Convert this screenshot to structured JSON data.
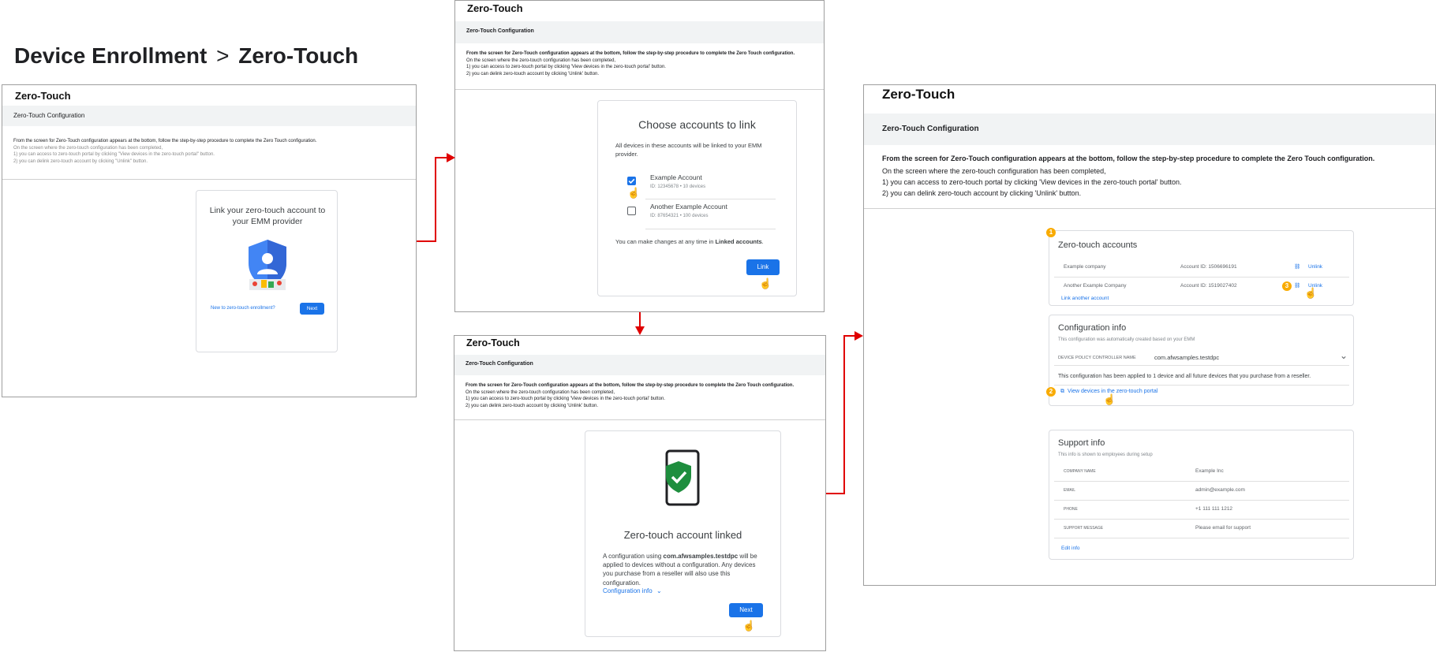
{
  "heading": {
    "left": "Device Enrollment",
    "separator": ">",
    "right": "Zero-Touch"
  },
  "common": {
    "panel_title": "Zero-Touch",
    "band_title": "Zero-Touch Configuration",
    "intro_bold": "From the screen for Zero-Touch configuration appears at the bottom, follow the step-by-step procedure to complete the Zero Touch configuration.",
    "line1": "On the screen where the zero-touch configuration has been completed,",
    "line2": "1) you can access to zero-touch portal by clicking 'View devices in the zero-touch portal' button.",
    "line3": "2) you can delink zero-touch account by clicking 'Unlink' button."
  },
  "panel1": {
    "line2": "1) you can access to zero-touch portal by clicking \"View devices in the zero-touch portal\" button.",
    "line3": "2) you can delink zero-touch account by clicking \"Unlink\" button.",
    "card_title": "Link your zero-touch account to your EMM provider",
    "new_link": "New to zero-touch enrollment?",
    "next_label": "Next"
  },
  "panel2": {
    "card_title": "Choose accounts to link",
    "card_desc": "All devices in these accounts will be linked to your EMM provider.",
    "accounts": [
      {
        "name": "Example Account",
        "meta": "ID: 12345678 • 10 devices",
        "checked": true
      },
      {
        "name": "Another Example Account",
        "meta": "ID: 87654321 • 100 devices",
        "checked": false
      }
    ],
    "note_prefix": "You can make changes at any time in ",
    "note_bold": "Linked accounts",
    "note_suffix": ".",
    "link_label": "Link"
  },
  "panel3": {
    "card_title": "Zero-touch account linked",
    "desc_prefix": "A configuration using ",
    "desc_bold": "com.afwsamples.testdpc",
    "desc_suffix": " will be applied to devices without a configuration. Any devices you purchase from a reseller will also use this configuration.",
    "config_link": "Configuration info",
    "next_label": "Next"
  },
  "panel4": {
    "accounts_section": {
      "badge": "1",
      "title": "Zero-touch accounts",
      "rows": [
        {
          "name": "Example company",
          "account": "Account ID: 1506696191",
          "action": "Unlink"
        },
        {
          "name": "Another Example Company",
          "account": "Account ID: 1519027402",
          "action": "Unlink"
        }
      ],
      "badge_unlink": "3",
      "link_another": "Link another account"
    },
    "config_section": {
      "title": "Configuration info",
      "subtitle": "This configuration was automatically created based on your EMM",
      "dpc_label": "DEVICE POLICY CONTROLLER NAME",
      "dpc_value": "com.afwsamples.testdpc",
      "applied_text": "This configuration has been applied to 1 device and all future devices that you purchase from a reseller.",
      "badge": "2",
      "view_link": "View devices in the zero-touch portal"
    },
    "support_section": {
      "title": "Support info",
      "subtitle": "This info is shown to employees during setup",
      "rows": [
        {
          "label": "COMPANY NAME",
          "value": "Example Inc"
        },
        {
          "label": "EMAIL",
          "value": "admin@example.com"
        },
        {
          "label": "PHONE",
          "value": "+1 111 111 1212"
        },
        {
          "label": "SUPPORT MESSAGE",
          "value": "Please email for support"
        }
      ],
      "edit_link": "Edit info"
    }
  },
  "colors": {
    "accent": "#1a73e8",
    "arrow": "#e00000",
    "badge": "#f9ab00",
    "check_green": "#1e8e3e"
  }
}
